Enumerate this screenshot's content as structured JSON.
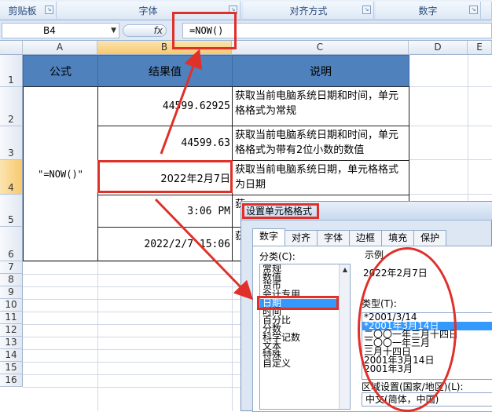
{
  "ribbon": {
    "groups": [
      {
        "label": "剪贴板"
      },
      {
        "label": "字体"
      },
      {
        "label": "对齐方式"
      },
      {
        "label": "数字"
      }
    ]
  },
  "formula_bar": {
    "name_box": "B4",
    "fx": "fx",
    "formula": "=NOW()"
  },
  "columns": [
    "A",
    "B",
    "C",
    "D",
    "E"
  ],
  "rows": [
    "1",
    "2",
    "3",
    "4",
    "5",
    "6",
    "7",
    "8",
    "9",
    "10",
    "11",
    "12",
    "13",
    "14",
    "15",
    "16"
  ],
  "table": {
    "header_formula": "公式",
    "header_result": "结果值",
    "header_desc": "说明",
    "formula_text": "\"=NOW()\"",
    "rows": [
      {
        "value": "44599.62925",
        "desc": "获取当前电脑系统日期和时间，单元格格式为常规"
      },
      {
        "value": "44599.63",
        "desc": "获取当前电脑系统日期和时间，单元格格式为带有2位小数的数值"
      },
      {
        "value": "2022年2月7日",
        "desc": "获取当前电脑系统日期，单元格格式为日期"
      },
      {
        "value": "3:06 PM",
        "desc": "获"
      },
      {
        "value": "2022/2/7 15:06",
        "desc": "获"
      }
    ]
  },
  "dialog": {
    "title": "设置单元格格式",
    "tabs": [
      "数字",
      "对齐",
      "字体",
      "边框",
      "填充",
      "保护"
    ],
    "category_label": "分类(C):",
    "categories": [
      "常规",
      "数值",
      "货币",
      "会计专用",
      "日期",
      "时间",
      "百分比",
      "分数",
      "科学记数",
      "文本",
      "特殊",
      "自定义"
    ],
    "selected_category": "日期",
    "sample_label": "示例",
    "sample_value": "2022年2月7日",
    "type_label": "类型(T):",
    "types": [
      "*2001/3/14",
      "*2001年3月14日",
      "二〇〇一年三月十四日",
      "二〇〇一年三月",
      "三月十四日",
      "2001年3月14日",
      "2001年3月"
    ],
    "selected_type": "*2001年3月14日",
    "locale_label": "区域设置(国家/地区)(L):",
    "locale_value": "中文(简体，中国)"
  },
  "colors": {
    "header_fill": "#4f81bd",
    "selection": "#3399ff",
    "annotation_red": "#e0302a"
  }
}
